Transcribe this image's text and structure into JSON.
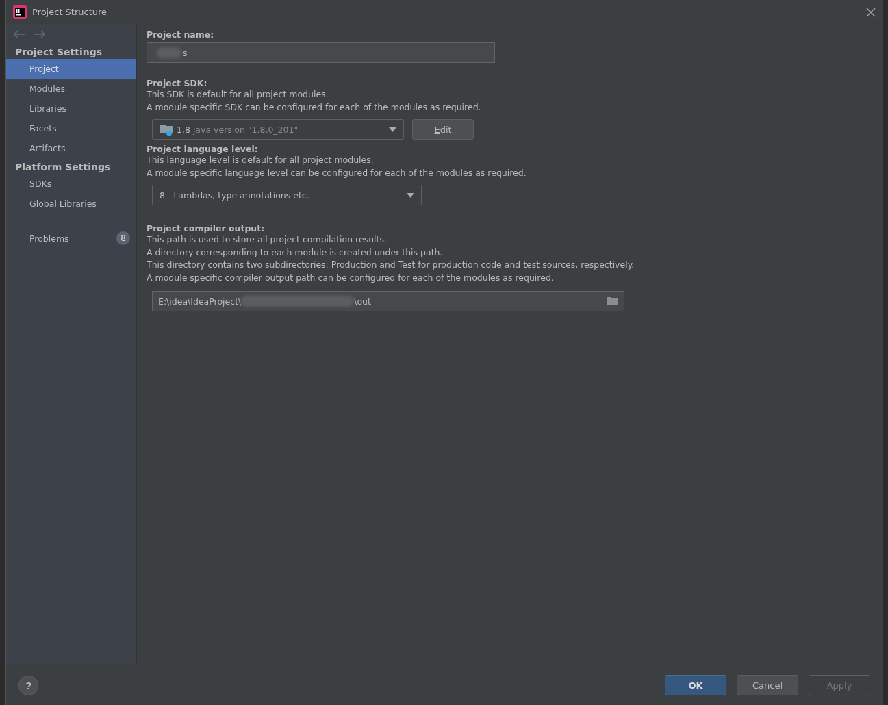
{
  "window": {
    "title": "Project Structure"
  },
  "sidebar": {
    "groups": [
      {
        "title": "Project Settings",
        "items": [
          {
            "label": "Project",
            "selected": true
          },
          {
            "label": "Modules",
            "selected": false
          },
          {
            "label": "Libraries",
            "selected": false
          },
          {
            "label": "Facets",
            "selected": false
          },
          {
            "label": "Artifacts",
            "selected": false
          }
        ]
      },
      {
        "title": "Platform Settings",
        "items": [
          {
            "label": "SDKs",
            "selected": false
          },
          {
            "label": "Global Libraries",
            "selected": false
          }
        ]
      }
    ],
    "problems": {
      "label": "Problems",
      "count": "8"
    }
  },
  "project_name": {
    "label": "Project name:",
    "value_end": "s"
  },
  "project_sdk": {
    "label": "Project SDK:",
    "lines": [
      "This SDK is default for all project modules.",
      "A module specific SDK can be configured for each of the modules as required."
    ],
    "version": "1.8",
    "detail": "java version \"1.8.0_201\"",
    "edit_button": "Edit"
  },
  "language_level": {
    "label": "Project language level:",
    "lines": [
      "This language level is default for all project modules.",
      "A module specific language level can be configured for each of the modules as required."
    ],
    "value": "8 - Lambdas, type annotations etc."
  },
  "compiler_output": {
    "label": "Project compiler output:",
    "lines": [
      "This path is used to store all project compilation results.",
      "A directory corresponding to each module is created under this path.",
      "This directory contains two subdirectories: Production and Test for production code and test sources, respectively.",
      "A module specific compiler output path can be configured for each of the modules as required."
    ],
    "path_start": "E:\\idea\\IdeaProject\\",
    "path_end": "\\out"
  },
  "help_button": "?",
  "buttons": [
    {
      "label": "OK",
      "kind": "default",
      "disabled": false
    },
    {
      "label": "Cancel",
      "kind": "normal",
      "disabled": false
    },
    {
      "label": "Apply",
      "kind": "normal",
      "disabled": true
    }
  ]
}
